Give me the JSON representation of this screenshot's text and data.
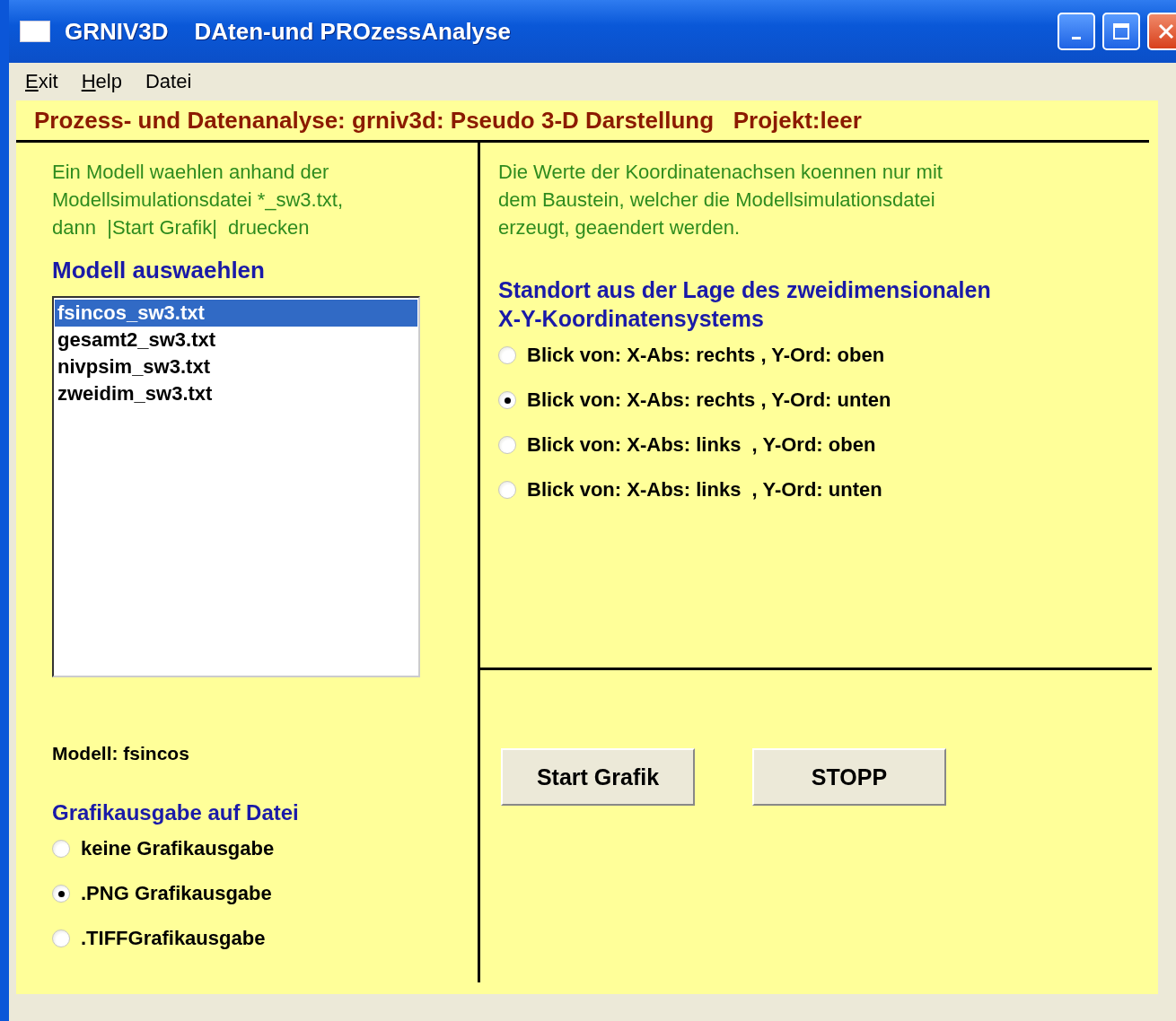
{
  "window": {
    "title": "GRNIV3D    DAten-und PROzessAnalyse"
  },
  "menu": [
    {
      "label": "Exit",
      "mnemonic_first": true
    },
    {
      "label": "Help",
      "mnemonic_first": true
    },
    {
      "label": "Datei",
      "mnemonic_first": false
    }
  ],
  "header": "Prozess- und Datenanalyse: grniv3d: Pseudo 3-D Darstellung   Projekt:leer",
  "left": {
    "instructions": [
      "Ein Modell waehlen anhand der",
      "Modellsimulationsdatei *_sw3.txt,",
      "dann  |Start Grafik|  druecken"
    ],
    "list_title": "Modell auswaehlen",
    "models": [
      {
        "label": "fsincos_sw3.txt",
        "selected": true
      },
      {
        "label": "gesamt2_sw3.txt",
        "selected": false
      },
      {
        "label": "nivpsim_sw3.txt",
        "selected": false
      },
      {
        "label": "zweidim_sw3.txt",
        "selected": false
      }
    ],
    "model_label": "Modell: fsincos",
    "output_title": "Grafikausgabe auf Datei",
    "output_options": [
      {
        "label": "keine Grafikausgabe",
        "selected": false
      },
      {
        "label": ".PNG Grafikausgabe",
        "selected": true
      },
      {
        "label": ".TIFFGrafikausgabe",
        "selected": false
      }
    ]
  },
  "right": {
    "note": [
      "Die Werte der Koordinatenachsen koennen nur mit",
      "dem Baustein, welcher die Modellsimulationsdatei",
      "erzeugt, geaendert werden."
    ],
    "view_title": [
      "Standort aus der Lage des zweidimensionalen",
      "X-Y-Koordinatensystems"
    ],
    "view_options": [
      {
        "label": "Blick von: X-Abs: rechts , Y-Ord: oben",
        "selected": false
      },
      {
        "label": "Blick von: X-Abs: rechts , Y-Ord: unten",
        "selected": true
      },
      {
        "label": "Blick von: X-Abs: links  , Y-Ord: oben",
        "selected": false
      },
      {
        "label": "Blick von: X-Abs: links  , Y-Ord: unten",
        "selected": false
      }
    ],
    "buttons": [
      "Start Grafik",
      "STOPP"
    ]
  }
}
